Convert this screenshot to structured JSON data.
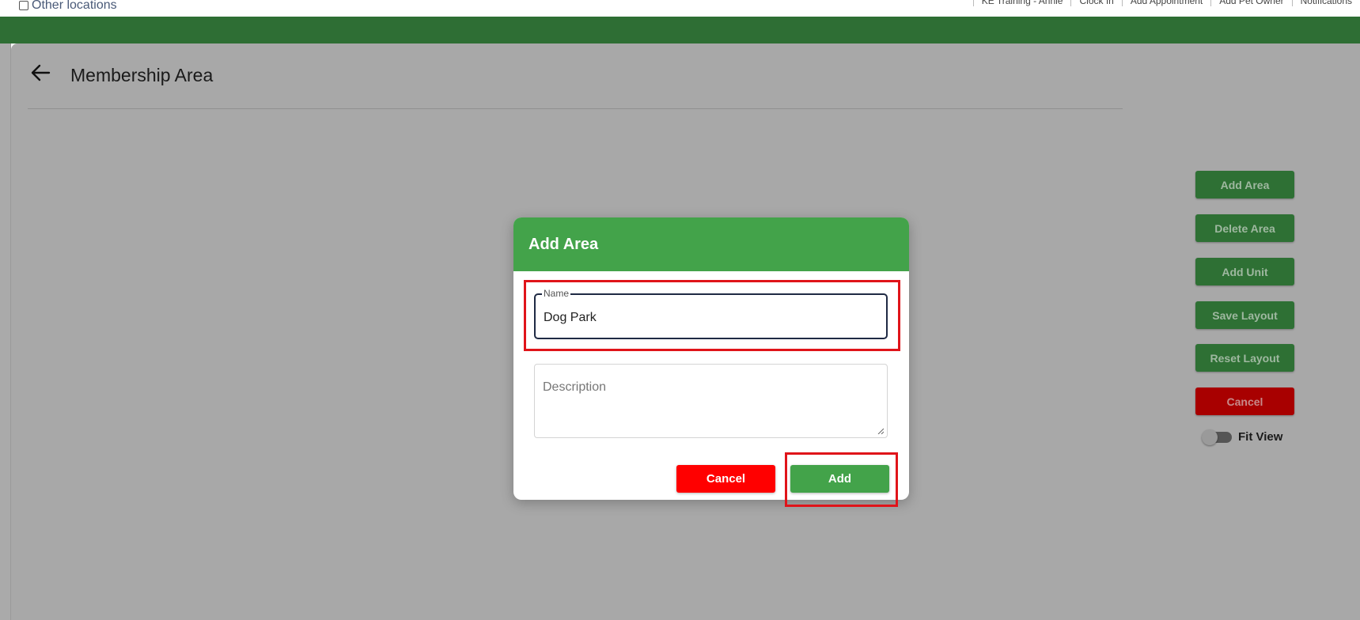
{
  "topbar": {
    "other_locations_label": "Other locations",
    "links": [
      "KE Training - Annie",
      "Clock In",
      "Add Appointment",
      "Add Pet Owner",
      "Notifications"
    ]
  },
  "page": {
    "title": "Membership Area"
  },
  "side_buttons": {
    "add_area": "Add Area",
    "delete_area": "Delete Area",
    "add_unit": "Add Unit",
    "save_layout": "Save Layout",
    "reset_layout": "Reset Layout",
    "cancel": "Cancel",
    "fit_view_label": "Fit View",
    "fit_view_on": false
  },
  "dialog": {
    "title": "Add Area",
    "name_label": "Name",
    "name_value": "Dog Park",
    "description_placeholder": "Description",
    "description_value": "",
    "cancel_label": "Cancel",
    "add_label": "Add"
  },
  "colors": {
    "header_green": "#2e6e34",
    "dialog_green": "#43a34a",
    "cancel_red": "#ff0000",
    "overlay_gray": "#a8a8a8",
    "highlight_red": "#e0141a"
  }
}
